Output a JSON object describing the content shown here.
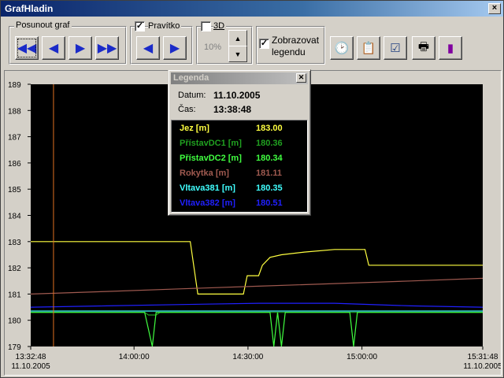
{
  "window": {
    "title": "GrafHladin",
    "close_glyph": "×"
  },
  "toolbar": {
    "shift_group": {
      "label": "Posunout graf",
      "buttons": [
        {
          "name": "shift-fast-left-button",
          "glyph": "◀◀"
        },
        {
          "name": "shift-left-button",
          "glyph": "◀"
        },
        {
          "name": "shift-right-button",
          "glyph": "▶"
        },
        {
          "name": "shift-fast-right-button",
          "glyph": "▶▶"
        }
      ]
    },
    "ruler_group": {
      "label": "Pravítko",
      "checked": true,
      "check_glyph": "✓",
      "buttons": [
        {
          "name": "ruler-left-button",
          "glyph": "◀"
        },
        {
          "name": "ruler-right-button",
          "glyph": "▶"
        }
      ]
    },
    "threed": {
      "label": "3D",
      "checked": false,
      "percent": "10%",
      "up_glyph": "▲",
      "down_glyph": "▼"
    },
    "show_legend": {
      "label_line1": "Zobrazovat",
      "label_line2": "legendu",
      "checked": true,
      "check_glyph": "✓"
    },
    "icons": [
      {
        "name": "clock-icon",
        "glyph": "🕑",
        "color": "#c00000"
      },
      {
        "name": "export-icon",
        "glyph": "📋",
        "color": "#806000"
      },
      {
        "name": "settings-list-icon",
        "glyph": "☑",
        "color": "#204080"
      },
      {
        "name": "print-icon",
        "glyph": "🖶",
        "color": "#303030"
      },
      {
        "name": "gauge-icon",
        "glyph": "▮",
        "color": "#8000a0"
      }
    ]
  },
  "legend": {
    "title": "Legenda",
    "close_glyph": "✕",
    "date_label": "Datum:",
    "date_value": "11.10.2005",
    "time_label": "Čas:",
    "time_value": "13:38:48",
    "rows": [
      {
        "label": "Jez [m]",
        "value": "183.00",
        "color": "#ffff40"
      },
      {
        "label": "PřístavDC1 [m]",
        "value": "180.36",
        "color": "#20a020"
      },
      {
        "label": "PřístavDC2 [m]",
        "value": "180.34",
        "color": "#40ff40"
      },
      {
        "label": "Rokytka [m]",
        "value": "181.11",
        "color": "#a05a50"
      },
      {
        "label": "Vltava381 [m]",
        "value": "180.35",
        "color": "#40ffff"
      },
      {
        "label": "Vltava382 [m]",
        "value": "180.51",
        "color": "#2020ff"
      }
    ]
  },
  "chart_data": {
    "type": "line",
    "ylim": [
      179,
      189
    ],
    "yticks": [
      "189",
      "188",
      "187",
      "186",
      "185",
      "184",
      "183",
      "182",
      "181",
      "180",
      "179"
    ],
    "x_start_min": 0,
    "x_end_min": 59,
    "xticks": [
      {
        "label": "13:32:48",
        "sub": "11.10.2005",
        "min": 0
      },
      {
        "label": "14:00:00",
        "sub": "",
        "min": 27.2
      },
      {
        "label": "14:30:00",
        "sub": "",
        "min": 57.2
      },
      {
        "label": "15:00:00",
        "sub": "",
        "min": 87.2
      },
      {
        "label": "15:31:48",
        "sub": "11.10.2005",
        "min": 119
      }
    ],
    "x_range_min": [
      0,
      119
    ],
    "cursor_min": 6,
    "cursor_color": "#e07020",
    "background": "#000000",
    "series": [
      {
        "name": "Jez [m]",
        "color": "#ffff40",
        "points": [
          [
            0,
            183.0
          ],
          [
            42,
            183.0
          ],
          [
            43,
            182.0
          ],
          [
            44,
            181.0
          ],
          [
            56,
            181.0
          ],
          [
            57,
            181.7
          ],
          [
            60,
            181.7
          ],
          [
            61,
            182.1
          ],
          [
            63,
            182.4
          ],
          [
            66,
            182.5
          ],
          [
            72,
            182.6
          ],
          [
            80,
            182.7
          ],
          [
            88,
            182.7
          ],
          [
            89,
            182.1
          ],
          [
            119,
            182.1
          ]
        ]
      },
      {
        "name": "Rokytka [m]",
        "color": "#a05a50",
        "points": [
          [
            0,
            181.0
          ],
          [
            20,
            181.1
          ],
          [
            40,
            181.2
          ],
          [
            60,
            181.3
          ],
          [
            80,
            181.4
          ],
          [
            100,
            181.5
          ],
          [
            119,
            181.6
          ]
        ]
      },
      {
        "name": "Vltava382 [m]",
        "color": "#2020ff",
        "points": [
          [
            0,
            180.5
          ],
          [
            20,
            180.55
          ],
          [
            40,
            180.6
          ],
          [
            60,
            180.65
          ],
          [
            80,
            180.65
          ],
          [
            100,
            180.55
          ],
          [
            119,
            180.5
          ]
        ]
      },
      {
        "name": "Vltava381 [m]",
        "color": "#40ffff",
        "points": [
          [
            0,
            180.35
          ],
          [
            119,
            180.35
          ]
        ]
      },
      {
        "name": "PřístavDC1 [m]",
        "color": "#20a020",
        "points": [
          [
            0,
            180.3
          ],
          [
            30,
            180.3
          ],
          [
            31,
            180.2
          ],
          [
            33,
            180.2
          ],
          [
            34,
            180.3
          ],
          [
            60,
            180.3
          ],
          [
            119,
            180.3
          ]
        ]
      },
      {
        "name": "PřístavDC2 [m]",
        "color": "#40ff40",
        "points": [
          [
            0,
            180.3
          ],
          [
            30,
            180.3
          ],
          [
            32,
            179.0
          ],
          [
            33,
            180.3
          ],
          [
            63,
            180.3
          ],
          [
            64,
            179.0
          ],
          [
            65,
            180.3
          ],
          [
            66,
            179.0
          ],
          [
            67,
            180.3
          ],
          [
            84,
            180.3
          ],
          [
            85,
            179.0
          ],
          [
            86,
            180.3
          ],
          [
            119,
            180.3
          ]
        ]
      }
    ]
  }
}
